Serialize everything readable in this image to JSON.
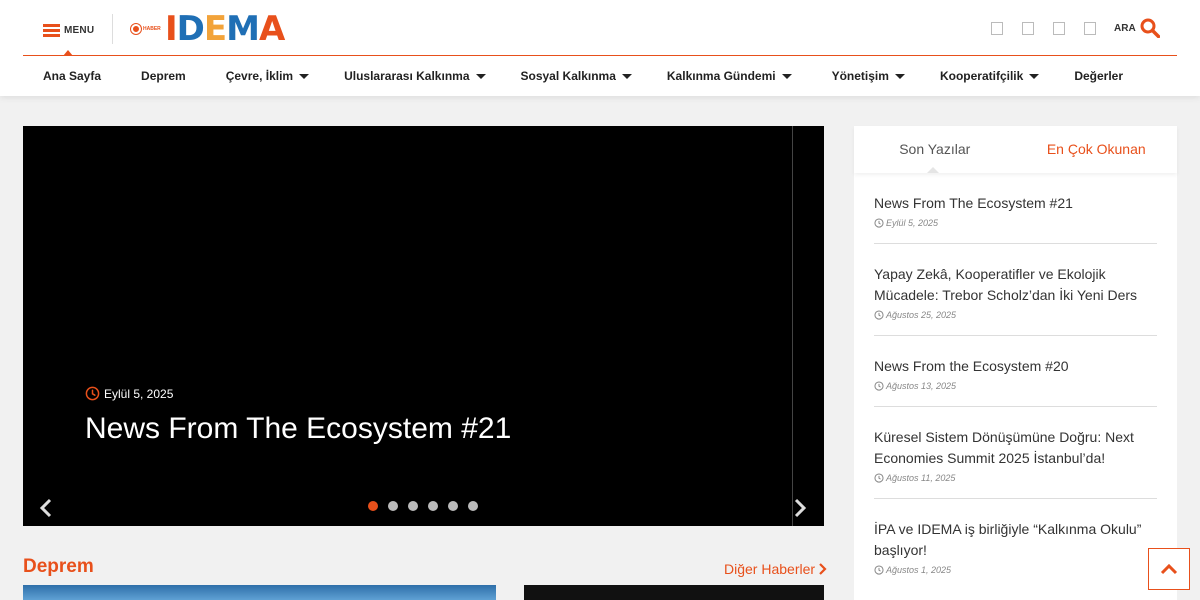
{
  "header": {
    "menu_label": "MENU",
    "logo": {
      "badge_text": "HABER",
      "letters": [
        "I",
        "D",
        "E",
        "M",
        "A"
      ]
    },
    "search_label": "ARA"
  },
  "nav": {
    "items": [
      {
        "label": "Ana Sayfa",
        "has_dropdown": false
      },
      {
        "label": "Deprem",
        "has_dropdown": false
      },
      {
        "label": "Çevre, İklim",
        "has_dropdown": true
      },
      {
        "label": "Uluslararası Kalkınma",
        "has_dropdown": true
      },
      {
        "label": "Sosyal Kalkınma",
        "has_dropdown": true
      },
      {
        "label": "Kalkınma Gündemi",
        "has_dropdown": true
      },
      {
        "label": "Yönetişim",
        "has_dropdown": true
      },
      {
        "label": "Kooperatifçilik",
        "has_dropdown": true
      },
      {
        "label": "Değerler",
        "has_dropdown": false
      }
    ]
  },
  "slider": {
    "date": "Eylül 5, 2025",
    "title": "News From The Ecosystem #21",
    "slide_count": 6,
    "active_slide": 1
  },
  "sidebar": {
    "tabs": [
      {
        "label": "Son Yazılar",
        "active": true
      },
      {
        "label": "En Çok Okunan",
        "active": false
      }
    ],
    "posts": [
      {
        "title": "News From The Ecosystem #21",
        "date": "Eylül 5, 2025"
      },
      {
        "title": "Yapay Zekâ, Kooperatifler ve Ekolojik Mücadele: Trebor Scholz’dan İki Yeni Ders",
        "date": "Ağustos 25, 2025"
      },
      {
        "title": "News From the Ecosystem #20",
        "date": "Ağustos 13, 2025"
      },
      {
        "title": "Küresel Sistem Dönüşümüne Doğru: Next Economies Summit 2025 İstanbul’da!",
        "date": "Ağustos 11, 2025"
      },
      {
        "title": "İPA ve IDEMA iş birliğiyle “Kalkınma Okulu” başlıyor!",
        "date": "Ağustos 1, 2025"
      }
    ]
  },
  "section": {
    "title": "Deprem",
    "more_label": "Diğer Haberler"
  },
  "colors": {
    "accent": "#e8501b",
    "logo_blue": "#1f6fb5",
    "logo_yellow": "#f2a33a"
  },
  "icons": {
    "menu": "hamburger-icon",
    "search": "search-icon",
    "date": "clock-icon",
    "prev": "chevron-left-icon",
    "next": "chevron-right-icon",
    "more": "chevron-right-icon",
    "to_top": "chevron-up-icon"
  }
}
